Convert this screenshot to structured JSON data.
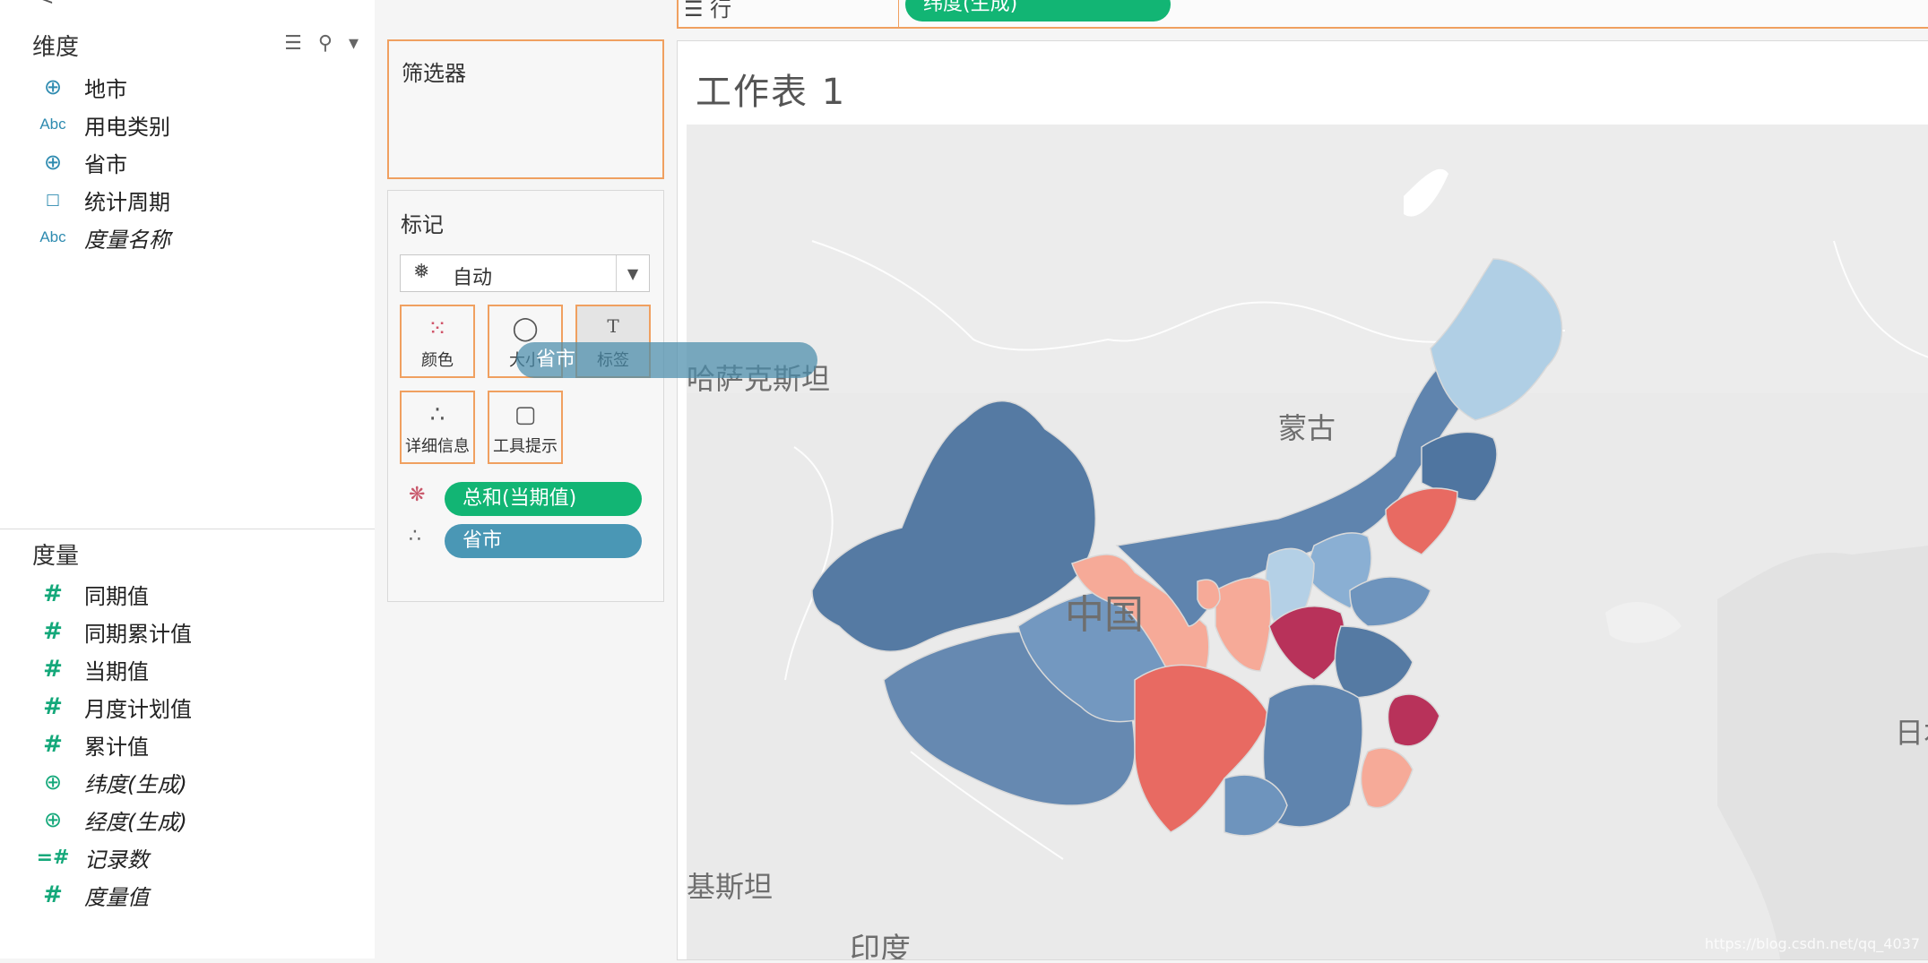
{
  "data_pane": {
    "top_cut_text": "<",
    "dimensions_header": "维度",
    "dimensions": [
      {
        "icon": "globe-icon",
        "icon_text": "⊕",
        "label": "地市",
        "italic": false
      },
      {
        "icon": "abc-icon",
        "icon_text": "Abc",
        "label": "用电类别",
        "italic": false
      },
      {
        "icon": "globe-icon",
        "icon_text": "⊕",
        "label": "省市",
        "italic": false
      },
      {
        "icon": "calendar-icon",
        "icon_text": "□",
        "label": "统计周期",
        "italic": false
      },
      {
        "icon": "abc-icon",
        "icon_text": "Abc",
        "label": "度量名称",
        "italic": true
      }
    ],
    "measures_header": "度量",
    "measures": [
      {
        "icon": "hash-icon",
        "icon_text": "#",
        "label": "同期值",
        "italic": false
      },
      {
        "icon": "hash-icon",
        "icon_text": "#",
        "label": "同期累计值",
        "italic": false
      },
      {
        "icon": "hash-icon",
        "icon_text": "#",
        "label": "当期值",
        "italic": false
      },
      {
        "icon": "hash-icon",
        "icon_text": "#",
        "label": "月度计划值",
        "italic": false
      },
      {
        "icon": "hash-icon",
        "icon_text": "#",
        "label": "累计值",
        "italic": false
      },
      {
        "icon": "globe-icon",
        "icon_text": "⊕",
        "label": "纬度(生成)",
        "italic": true
      },
      {
        "icon": "globe-icon",
        "icon_text": "⊕",
        "label": "经度(生成)",
        "italic": true
      },
      {
        "icon": "hash-icon",
        "icon_text": "=#",
        "label": "记录数",
        "italic": true
      },
      {
        "icon": "hash-icon",
        "icon_text": "#",
        "label": "度量值",
        "italic": true
      }
    ]
  },
  "filters": {
    "title": "筛选器"
  },
  "marks": {
    "title": "标记",
    "mark_type": "自动",
    "buttons": [
      {
        "name": "color",
        "label": "颜色",
        "icon": "color-dots-icon",
        "icon_text": "⁙"
      },
      {
        "name": "size",
        "label": "大小",
        "icon": "size-circles-icon",
        "icon_text": "◯"
      },
      {
        "name": "label",
        "label": "标签",
        "icon": "label-text-icon",
        "icon_text": "T"
      },
      {
        "name": "detail",
        "label": "详细信息",
        "icon": "detail-dots-icon",
        "icon_text": "∴"
      },
      {
        "name": "tooltip",
        "label": "工具提示",
        "icon": "tooltip-icon",
        "icon_text": "▢"
      }
    ],
    "pills": [
      {
        "type": "color",
        "label": "总和(当期值)"
      },
      {
        "type": "detail",
        "label": "省市"
      }
    ]
  },
  "drag_pill": {
    "label": "省市"
  },
  "rows_shelf": {
    "label": "行",
    "pill": "纬度(生成)"
  },
  "worksheet": {
    "title": "工作表 1",
    "map_labels": {
      "kazakhstan": "哈萨克斯坦",
      "mongolia": "蒙古",
      "china": "中国",
      "japan": "日本",
      "india": "印度",
      "pakistan": "基斯坦"
    },
    "watermark": "https://blog.csdn.net/qq_4037"
  },
  "colors": {
    "accent_orange": "#f0a060",
    "pill_green": "#12b574",
    "pill_teal": "#4a97b5",
    "map_dark_blue": "#557aa3",
    "map_mid_blue": "#6e94bd",
    "map_light_blue": "#a9c8e0",
    "map_salmon": "#e86a62",
    "map_light_salmon": "#f6aa98",
    "map_crimson": "#b8325a"
  }
}
